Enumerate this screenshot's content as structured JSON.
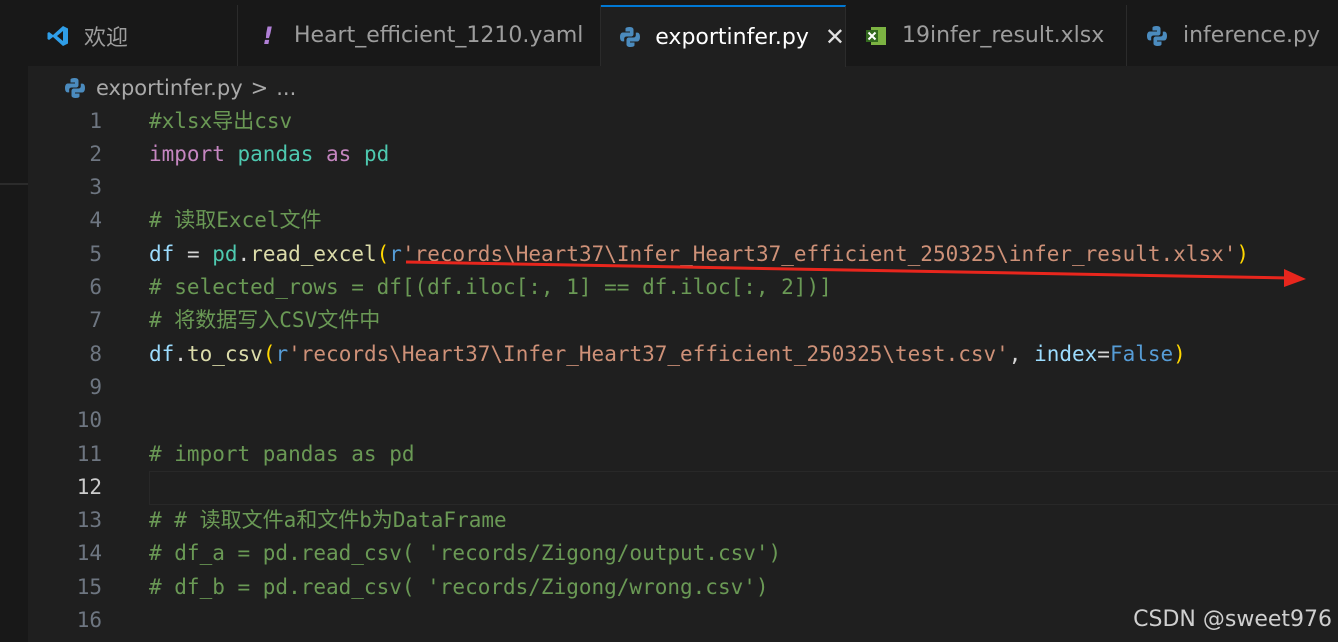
{
  "tabs": [
    {
      "label": "欢迎",
      "icon": "vscode-icon",
      "active": false
    },
    {
      "label": "Heart_efficient_1210.yaml",
      "icon": "exclamation-icon",
      "active": false
    },
    {
      "label": "exportinfer.py",
      "icon": "python-icon",
      "active": true,
      "close": "✕"
    },
    {
      "label": "19infer_result.xlsx",
      "icon": "excel-icon",
      "active": false
    },
    {
      "label": "inference.py",
      "icon": "python-icon",
      "active": false
    }
  ],
  "breadcrumb": {
    "file": "exportinfer.py",
    "separator": ">",
    "rest": "..."
  },
  "editor": {
    "current_line": "12",
    "lines": [
      {
        "n": "1"
      },
      {
        "n": "2"
      },
      {
        "n": "3"
      },
      {
        "n": "4"
      },
      {
        "n": "5"
      },
      {
        "n": "6"
      },
      {
        "n": "7"
      },
      {
        "n": "8"
      },
      {
        "n": "9"
      },
      {
        "n": "10"
      },
      {
        "n": "11"
      },
      {
        "n": "12"
      },
      {
        "n": "13"
      },
      {
        "n": "14"
      },
      {
        "n": "15"
      },
      {
        "n": "16"
      }
    ],
    "code": {
      "l1": "#xlsx导出csv",
      "l2_import": "import",
      "l2_mod": "pandas",
      "l2_as": "as",
      "l2_alias": "pd",
      "l4": "# 读取Excel文件",
      "l5_df": "df",
      "l5_eq": " = ",
      "l5_pd": "pd",
      "l5_dot": ".",
      "l5_fn": "read_excel",
      "l5_open": "(",
      "l5_r": "r",
      "l5_str": "'records\\Heart37\\Infer_Heart37_efficient_250325\\infer_result.xlsx'",
      "l5_close": ")",
      "l6": "# selected_rows = df[(df.iloc[:, 1] == df.iloc[:, 2])]",
      "l7": "# 将数据写入CSV文件中",
      "l8_df": "df",
      "l8_dot": ".",
      "l8_fn": "to_csv",
      "l8_open": "(",
      "l8_r": "r",
      "l8_str": "'records\\Heart37\\Infer_Heart37_efficient_250325\\test.csv'",
      "l8_comma": ", ",
      "l8_kw": "index",
      "l8_eq": "=",
      "l8_false": "False",
      "l8_close": ")",
      "l11": "# import pandas as pd",
      "l13": "# # 读取文件a和文件b为DataFrame",
      "l14": "# df_a = pd.read_csv( 'records/Zigong/output.csv')",
      "l15": "# df_b = pd.read_csv( 'records/Zigong/wrong.csv')"
    }
  },
  "colors": {
    "arrow": "#e8261d",
    "accent": "#0078d4"
  },
  "watermark": "CSDN @sweet976"
}
